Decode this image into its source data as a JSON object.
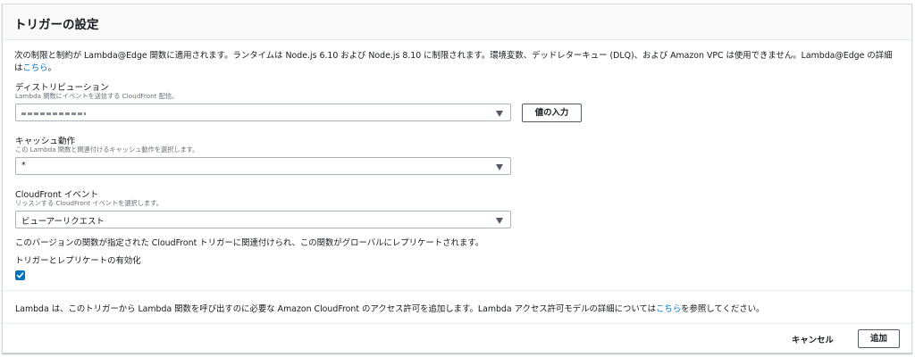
{
  "header": {
    "title": "トリガーの設定"
  },
  "intro": {
    "text": "次の制限と制約が Lambda@Edge 関数に適用されます。ランタイムは Node.js 6.10 および Node.js 8.10 に制限されます。環境変数、デッドレターキュー (DLQ)、および Amazon VPC は使用できません。Lambda@Edge の詳細は",
    "link": "こちら",
    "suffix": "。"
  },
  "distribution": {
    "label": "ディストリビューション",
    "description": "Lambda 関数にイベントを送信する CloudFront 配信。",
    "value": "",
    "enter_value_button": "値の入力"
  },
  "cache_behavior": {
    "label": "キャッシュ動作",
    "description": "この Lambda 関数と関連付けるキャッシュ動作を選択します。",
    "value": "*"
  },
  "cloudfront_event": {
    "label": "CloudFront イベント",
    "description": "リッスンする CloudFront イベントを選択します。",
    "value": "ビューアーリクエスト"
  },
  "replication_note": "このバージョンの関数が指定された CloudFront トリガーに関連付けられ、この関数がグローバルにレプリケートされます。",
  "replication_toggle": {
    "label": "トリガーとレプリケートの有効化",
    "checked": true
  },
  "permission_note": {
    "text": "Lambda は、このトリガーから Lambda 関数を呼び出すのに必要な Amazon CloudFront のアクセス許可を追加します。Lambda アクセス許可モデルの詳細については",
    "link": "こちら",
    "suffix": "を参照してください。"
  },
  "footer": {
    "cancel_label": "キャンセル",
    "add_label": "追加"
  },
  "colors": {
    "accent": "#0073bb",
    "text": "#16191f",
    "muted": "#687078"
  },
  "icons": {
    "dropdown": "caret-down-icon",
    "checkbox": "checkmark-icon"
  }
}
